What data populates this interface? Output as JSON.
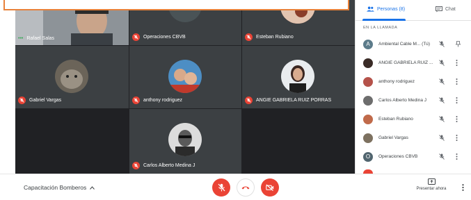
{
  "participants": [
    {
      "name": "Rafael Salas",
      "status": "speaking"
    },
    {
      "name": "Operaciones CBVB",
      "initial": "O",
      "status": "muted"
    },
    {
      "name": "Esteban Rubiano",
      "status": "muted"
    },
    {
      "name": "Gabriel Vargas",
      "status": "muted"
    },
    {
      "name": "anthony rodriguez",
      "status": "muted"
    },
    {
      "name": "ANGIE GABRIELA RUIZ PORRAS",
      "status": "muted"
    },
    {
      "name": "Carlos Alberto Medina J",
      "status": "muted"
    }
  ],
  "panel": {
    "tab_people": "Personas (8)",
    "tab_chat": "Chat",
    "section": "EN LA LLAMADA",
    "people": [
      {
        "name": "Ambiental Cable M...",
        "suffix": "(Tú)",
        "initial": "A",
        "color": "#5c7b8a"
      },
      {
        "name": "ANGIE GABRIELA RUIZ ...",
        "color": "#3a2b27"
      },
      {
        "name": "anthony rodriguez",
        "color": "#b5524a"
      },
      {
        "name": "Carlos Alberto Medina J",
        "color": "#6d6d6d"
      },
      {
        "name": "Esteban Rubiano",
        "color": "#c06a4a"
      },
      {
        "name": "Gabriel Vargas",
        "color": "#7d7160"
      },
      {
        "name": "Operaciones CBVB",
        "initial": "O",
        "color": "#51656f"
      }
    ]
  },
  "bottom": {
    "meeting_name": "Capacitación Bomberos",
    "present_label": "Presentar ahora"
  },
  "colors": {
    "accent": "#1a73e8",
    "danger": "#ea4335",
    "tile_bg": "#3c4043",
    "grid_bg": "#202124"
  }
}
